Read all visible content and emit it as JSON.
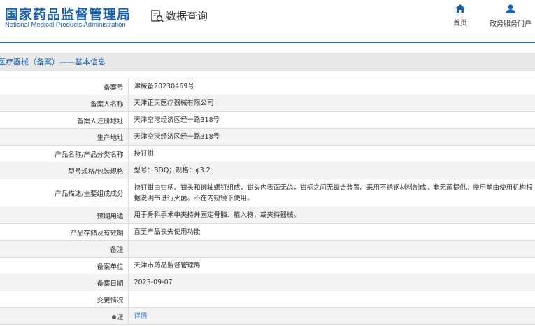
{
  "header": {
    "logo_cn": "国家药品监督管理局",
    "logo_en": "National Medical Products Administration",
    "query": "数据查询",
    "nav": [
      {
        "label": "首页",
        "icon": "home-icon"
      },
      {
        "label": "政务服务门户",
        "icon": "user-icon"
      }
    ]
  },
  "section_title": "医疗器械（备案）——基本信息",
  "rows": [
    {
      "label": "备案号",
      "value": "津械备20230469号"
    },
    {
      "label": "备案人名称",
      "value": "天津正天医疗器械有限公司"
    },
    {
      "label": "备案人注册地址",
      "value": "天津空港经济区经一路318号"
    },
    {
      "label": "生产地址",
      "value": "天津空港经济区经一路318号"
    },
    {
      "label": "产品名称/产品分类名称",
      "value": "持钉钳"
    },
    {
      "label": "型号规格/包装规格",
      "value": "型号：BDQ；规格：φ3.2"
    },
    {
      "label": "产品描述/主要组成成分",
      "value": "持钉钳由钳柄、钳头和铆轴螺钉组成，钳头内表面无齿，钳柄之间无锁合装置。采用不锈钢材料制成。非无菌提供。使用前由使用机构根据说明书进行灭菌。不在内窥镜下使用。"
    },
    {
      "label": "预期用途",
      "value": "用于骨科手术中夹持并固定骨骼、植入物，或夹持器械。"
    },
    {
      "label": "产品存储及有效期",
      "value": "直至产品丧失使用功能"
    },
    {
      "label": "备注",
      "value": ""
    },
    {
      "label": "备案单位",
      "value": "天津市药品监督管理局"
    },
    {
      "label": "备案日期",
      "value": "2023-09-07"
    },
    {
      "label": "变更情况",
      "value": ""
    },
    {
      "label": "注",
      "value": "详情"
    }
  ]
}
